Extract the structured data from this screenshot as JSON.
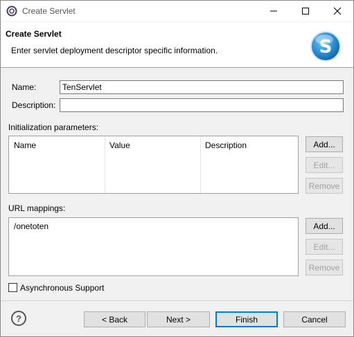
{
  "window": {
    "title": "Create Servlet"
  },
  "header": {
    "title": "Create Servlet",
    "description": "Enter servlet deployment descriptor specific information."
  },
  "form": {
    "name_label": "Name:",
    "name_value": "TenServlet",
    "description_label": "Description:",
    "description_value": ""
  },
  "init_params": {
    "label": "Initialization parameters:",
    "columns": [
      "Name",
      "Value",
      "Description"
    ],
    "add_label": "Add...",
    "edit_label": "Edit...",
    "remove_label": "Remove"
  },
  "url_mappings": {
    "label": "URL mappings:",
    "items": [
      "/onetoten"
    ],
    "add_label": "Add...",
    "edit_label": "Edit...",
    "remove_label": "Remove"
  },
  "async": {
    "label": "Asynchronous Support",
    "checked": false
  },
  "footer": {
    "help_glyph": "?",
    "back_label": "< Back",
    "next_label": "Next >",
    "finish_label": "Finish",
    "cancel_label": "Cancel"
  },
  "icons": {
    "app": "eclipse-icon",
    "logo": "servlet-s-icon",
    "help": "help-icon"
  },
  "colors": {
    "accent": "#0078d7",
    "logo_blue": "#2a8fd6"
  }
}
